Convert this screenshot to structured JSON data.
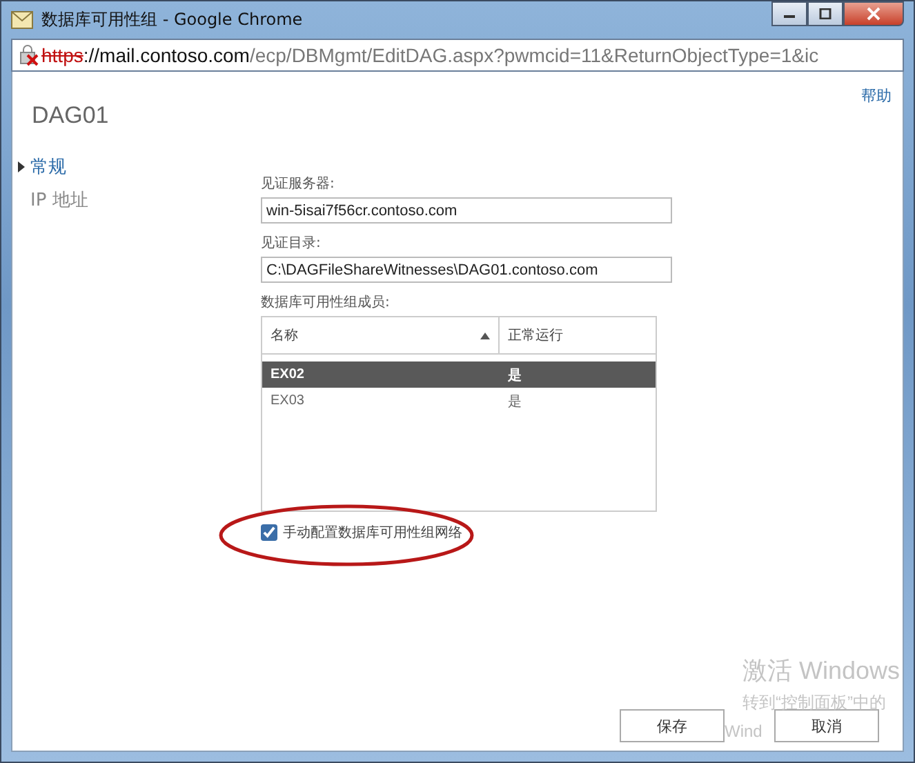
{
  "window": {
    "title": "数据库可用性组 - Google Chrome"
  },
  "address_bar": {
    "insecure": true,
    "scheme": "https",
    "host": "://mail.contoso.com",
    "path": "/ecp/DBMgmt/EditDAG.aspx?pwmcid=11&ReturnObjectType=1&ic"
  },
  "help_link": "帮助",
  "heading": "DAG01",
  "nav": [
    {
      "label": "常规",
      "selected": true
    },
    {
      "label": "IP 地址",
      "selected": false
    }
  ],
  "fields": [
    {
      "label": "见证服务器:",
      "value": "win-5isai7f56cr.contoso.com"
    },
    {
      "label": "见证目录:",
      "value": "C:\\DAGFileShareWitnesses\\DAG01.contoso.com"
    }
  ],
  "members": {
    "label": "数据库可用性组成员:",
    "columns": [
      "名称",
      "正常运行"
    ],
    "rows": [
      {
        "cells": [
          "EX02",
          "是"
        ],
        "selected": true
      },
      {
        "cells": [
          "EX03",
          "是"
        ],
        "selected": false
      }
    ]
  },
  "manual_network": {
    "label": "手动配置数据库可用性组网络",
    "checked": true
  },
  "buttons": [
    "保存",
    "取消"
  ],
  "activation_notice": [
    "激活 Windows",
    "转到“控制面板”中的",
    "Wind"
  ]
}
